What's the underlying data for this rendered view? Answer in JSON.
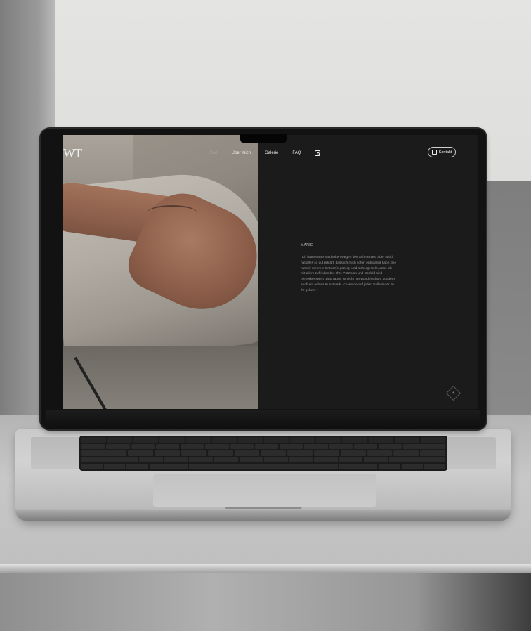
{
  "site": {
    "logo": "WT",
    "nav": [
      {
        "label": "Start",
        "active": true
      },
      {
        "label": "Über mich",
        "active": false
      },
      {
        "label": "Galerie",
        "active": false
      },
      {
        "label": "FAQ",
        "active": false
      }
    ],
    "instagram_icon": "instagram-icon",
    "contact_button": {
      "label": "Kontakt",
      "icon": "calendar-icon"
    },
    "testimonial": {
      "name": "MARIE",
      "text": "\"Ich hatte etwas Bedenken wegen des Schmerzes, aber Nicki hat alles so gut erklärt, dass ich mich sofort entspannt habe. Sie hat mir mehrere Entwürfe gezeigt und sichergestellt, dass ich mit allem zufrieden bin. Ihre Präzision und Geduld sind bemerkenswert. Das Tattoo ist nicht nur wunderschön, sondern auch ein echtes Kunstwerk. Ich werde auf jeden Fall wieder zu ihr gehen. \""
    },
    "scroll_button": "+",
    "colors": {
      "panel_bg": "#1b1b1b",
      "text_primary": "#f0f0f0",
      "text_muted": "#9a9a9a"
    }
  }
}
